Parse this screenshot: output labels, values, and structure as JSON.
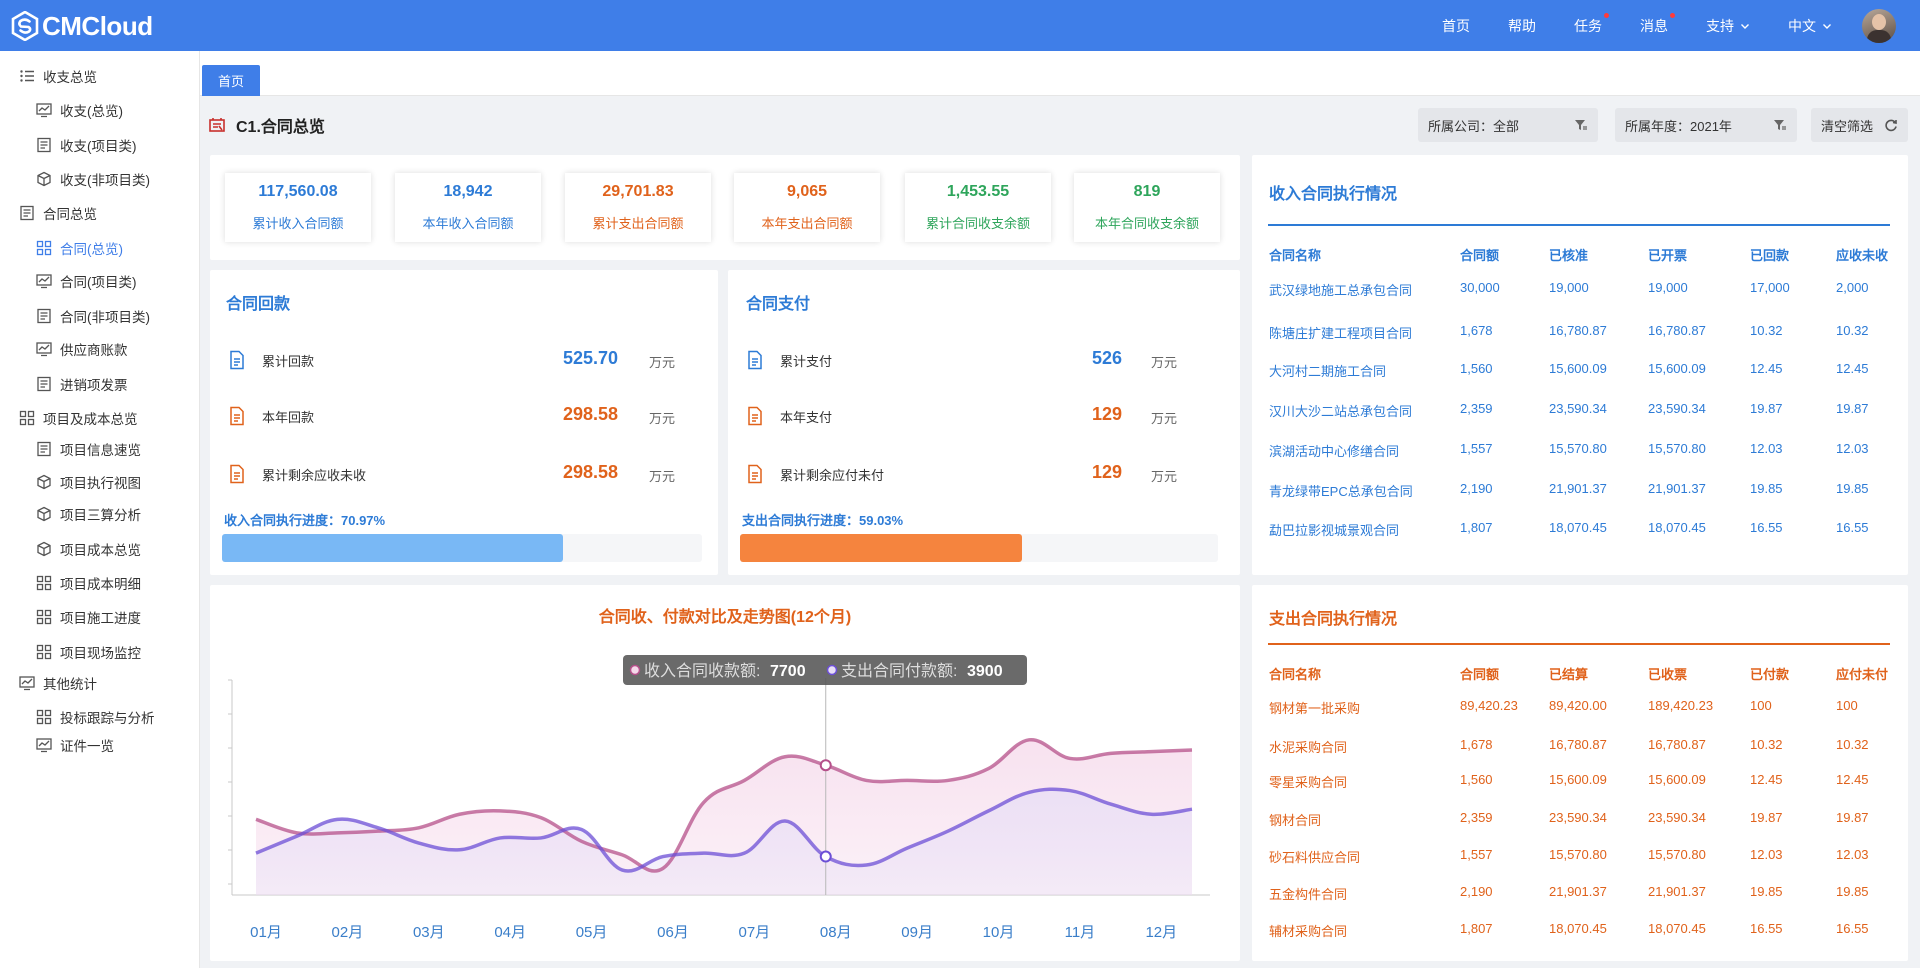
{
  "app": {
    "logo_text": "CMCloud"
  },
  "nav": {
    "items": [
      {
        "label": "首页",
        "dot": false,
        "chevron": false
      },
      {
        "label": "帮助",
        "dot": false,
        "chevron": false
      },
      {
        "label": "任务",
        "dot": true,
        "chevron": false
      },
      {
        "label": "消息",
        "dot": true,
        "chevron": false
      },
      {
        "label": "支持",
        "dot": false,
        "chevron": true
      },
      {
        "label": "中文",
        "dot": false,
        "chevron": true
      }
    ]
  },
  "sidebar": {
    "items": [
      {
        "label": "收支总览",
        "level": 0,
        "icon": "list-icon",
        "active": false
      },
      {
        "label": "收支(总览)",
        "level": 1,
        "icon": "monitor-chart-icon",
        "active": false
      },
      {
        "label": "收支(项目类)",
        "level": 1,
        "icon": "report-icon",
        "active": false
      },
      {
        "label": "收支(非项目类)",
        "level": 1,
        "icon": "cube-icon",
        "active": false
      },
      {
        "label": "合同总览",
        "level": 0,
        "icon": "report-icon",
        "active": false
      },
      {
        "label": "合同(总览)",
        "level": 1,
        "icon": "grid-icon",
        "active": true
      },
      {
        "label": "合同(项目类)",
        "level": 1,
        "icon": "monitor-chart-icon",
        "active": false
      },
      {
        "label": "合同(非项目类)",
        "level": 1,
        "icon": "report-icon",
        "active": false
      },
      {
        "label": "供应商账款",
        "level": 1,
        "icon": "monitor-chart-icon",
        "active": false
      },
      {
        "label": "进销项发票",
        "level": 1,
        "icon": "report-icon",
        "active": false
      },
      {
        "label": "项目及成本总览",
        "level": 0,
        "icon": "grid-icon",
        "active": false
      },
      {
        "label": "项目信息速览",
        "level": 1,
        "icon": "report-icon",
        "active": false
      },
      {
        "label": "项目执行视图",
        "level": 1,
        "icon": "cube-icon",
        "active": false
      },
      {
        "label": "项目三算分析",
        "level": 1,
        "icon": "cube-icon",
        "active": false
      },
      {
        "label": "项目成本总览",
        "level": 1,
        "icon": "cube-icon",
        "active": false
      },
      {
        "label": "项目成本明细",
        "level": 1,
        "icon": "grid-icon",
        "active": false
      },
      {
        "label": "项目施工进度",
        "level": 1,
        "icon": "grid-icon",
        "active": false
      },
      {
        "label": "项目现场监控",
        "level": 1,
        "icon": "grid-icon",
        "active": false
      },
      {
        "label": "其他统计",
        "level": 0,
        "icon": "monitor-chart-icon",
        "active": false
      },
      {
        "label": "投标跟踪与分析",
        "level": 1,
        "icon": "grid-icon",
        "active": false
      },
      {
        "label": "证件一览",
        "level": 1,
        "icon": "monitor-chart-icon",
        "active": false
      }
    ]
  },
  "tabs": [
    {
      "label": "首页"
    }
  ],
  "page": {
    "title": "C1.合同总览"
  },
  "filters": {
    "company": "所属公司：全部",
    "year": "所属年度：2021年",
    "clear": "清空筛选"
  },
  "stats": [
    {
      "value": "117,560.08",
      "label": "累计收入合同额",
      "color": "#2d7bd6"
    },
    {
      "value": "18,942",
      "label": "本年收入合同额",
      "color": "#2d7bd6"
    },
    {
      "value": "29,701.83",
      "label": "累计支出合同额",
      "color": "#e0621b"
    },
    {
      "value": "9,065",
      "label": "本年支出合同额",
      "color": "#e0621b"
    },
    {
      "value": "1,453.55",
      "label": "累计合同收支余额",
      "color": "#2ea55b"
    },
    {
      "value": "819",
      "label": "本年合同收支余额",
      "color": "#2ea55b"
    }
  ],
  "receipts": {
    "title": "合同回款",
    "rows": [
      {
        "label": "累计回款",
        "value": "525.70",
        "unit": "万元",
        "color": "#2d7bd6"
      },
      {
        "label": "本年回款",
        "value": "298.58",
        "unit": "万元",
        "color": "#e0621b"
      },
      {
        "label": "累计剩余应收未收",
        "value": "298.58",
        "unit": "万元",
        "color": "#e0621b"
      }
    ],
    "progress_label": "收入合同执行进度：70.97%",
    "progress": 70.97,
    "bar_color": "#79b8f5"
  },
  "payments": {
    "title": "合同支付",
    "rows": [
      {
        "label": "累计支付",
        "value": "526",
        "unit": "万元",
        "color": "#2d7bd6"
      },
      {
        "label": "本年支付",
        "value": "129",
        "unit": "万元",
        "color": "#e0621b"
      },
      {
        "label": "累计剩余应付未付",
        "value": "129",
        "unit": "万元",
        "color": "#e0621b"
      }
    ],
    "progress_label": "支出合同执行进度：59.03%",
    "progress": 59.03,
    "bar_color": "#f5843e"
  },
  "income_table": {
    "title": "收入合同执行情况",
    "headers": [
      "合同名称",
      "合同额",
      "已核准",
      "已开票",
      "已回款",
      "应收未收"
    ],
    "rows": [
      [
        "武汉绿地施工总承包合同",
        "30,000",
        "19,000",
        "19,000",
        "17,000",
        "2,000"
      ],
      [
        "陈塘庄扩建工程项目合同",
        "1,678",
        "16,780.87",
        "16,780.87",
        "10.32",
        "10.32"
      ],
      [
        "大河村二期施工合同",
        "1,560",
        "15,600.09",
        "15,600.09",
        "12.45",
        "12.45"
      ],
      [
        "汉川大沙二站总承包合同",
        "2,359",
        "23,590.34",
        "23,590.34",
        "19.87",
        "19.87"
      ],
      [
        "滨湖活动中心修缮合同",
        "1,557",
        "15,570.80",
        "15,570.80",
        "12.03",
        "12.03"
      ],
      [
        "青龙绿带EPC总承包合同",
        "2,190",
        "21,901.37",
        "21,901.37",
        "19.85",
        "19.85"
      ],
      [
        "勐巴拉影视城景观合同",
        "1,807",
        "18,070.45",
        "18,070.45",
        "16.55",
        "16.55"
      ]
    ]
  },
  "expense_table": {
    "title": "支出合同执行情况",
    "headers": [
      "合同名称",
      "合同额",
      "已结算",
      "已收票",
      "已付款",
      "应付未付"
    ],
    "rows": [
      [
        "钢材第一批采购",
        "89,420.23",
        "89,420.00",
        "189,420.23",
        "100",
        "100"
      ],
      [
        "水泥采购合同",
        "1,678",
        "16,780.87",
        "16,780.87",
        "10.32",
        "10.32"
      ],
      [
        "零星采购合同",
        "1,560",
        "15,600.09",
        "15,600.09",
        "12.45",
        "12.45"
      ],
      [
        "钢材合同",
        "2,359",
        "23,590.34",
        "23,590.34",
        "19.87",
        "19.87"
      ],
      [
        "砂石料供应合同",
        "1,557",
        "15,570.80",
        "15,570.80",
        "12.03",
        "12.03"
      ],
      [
        "五金构件合同",
        "2,190",
        "21,901.37",
        "21,901.37",
        "19.85",
        "19.85"
      ],
      [
        "辅材采购合同",
        "1,807",
        "18,070.45",
        "18,070.45",
        "16.55",
        "16.55"
      ]
    ]
  },
  "chart_data": {
    "type": "line",
    "title": "合同收、付款对比及走势图(12个月)",
    "categories": [
      "01月",
      "02月",
      "03月",
      "04月",
      "05月",
      "06月",
      "07月",
      "08月",
      "09月",
      "10月",
      "11月",
      "12月"
    ],
    "ylim": [
      0,
      12000
    ],
    "series": [
      {
        "name": "收入合同收款额",
        "color": "#b5508a",
        "fill": "#f5d8ea",
        "x": [
          0,
          0.5,
          1,
          1.5,
          2,
          2.5,
          3,
          3.5,
          4,
          4.5,
          5,
          5.5,
          6,
          6.5,
          7,
          7.5,
          8,
          8.5,
          9,
          9.5,
          10,
          10.5,
          11,
          11.5
        ],
        "values": [
          4000,
          3200,
          3200,
          3300,
          3500,
          4300,
          4500,
          4100,
          2700,
          1900,
          1100,
          5000,
          6300,
          7700,
          7200,
          6300,
          6300,
          6300,
          7000,
          8700,
          7600,
          7900,
          8000,
          8100
        ]
      },
      {
        "name": "支出合同付款额",
        "color": "#6c4fd6",
        "fill": "#e7def6",
        "x": [
          0,
          0.5,
          1,
          1.5,
          2,
          2.5,
          3,
          3.5,
          4,
          4.5,
          5,
          5.5,
          6,
          6.5,
          7,
          7.5,
          8,
          8.5,
          9,
          9.5,
          10,
          10.5,
          11,
          11.5
        ],
        "values": [
          2000,
          3000,
          4000,
          3500,
          2600,
          2200,
          2900,
          2900,
          3400,
          1000,
          1800,
          2000,
          2000,
          3900,
          1800,
          1300,
          2300,
          3300,
          4500,
          5600,
          5700,
          4900,
          4300,
          4600
        ]
      }
    ],
    "tooltip": {
      "category_index": 7,
      "items": [
        {
          "name": "收入合同收款额",
          "value": "7700"
        },
        {
          "name": "支出合同付款额",
          "value": "3900"
        }
      ]
    }
  }
}
